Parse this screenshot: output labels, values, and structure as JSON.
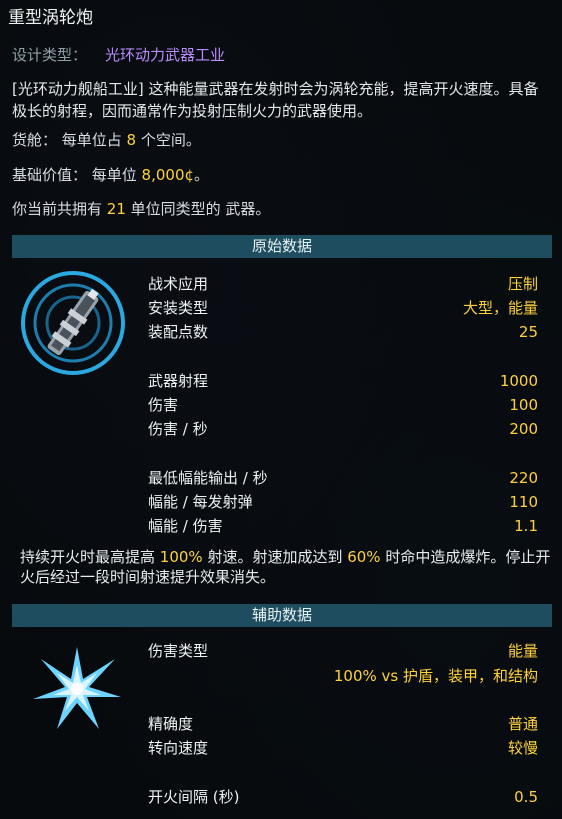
{
  "weapon": {
    "name": "重型涡轮炮",
    "design_type_label": "设计类型：",
    "design_type_value": "光环动力武器工业",
    "description": "[光环动力舰船工业] 这种能量武器在发射时会为涡轮充能，提高开火速度。具备极长的射程，因而通常作为投射压制火力的武器使用。",
    "cargo_prefix": "货舱：  每单位占 ",
    "cargo_value": "8",
    "cargo_suffix": " 个空间。",
    "price_prefix": "基础价值：  每单位 ",
    "price_value": "8,000¢",
    "price_suffix": "。",
    "own_prefix": "你当前共拥有 ",
    "own_value": "21",
    "own_suffix": " 单位同类型的 武器。"
  },
  "primary": {
    "header": "原始数据",
    "icon": "turbo-cannon-weapon-icon",
    "rows": [
      {
        "label": "战术应用",
        "value": "压制"
      },
      {
        "label": "安装类型",
        "value": "大型，能量"
      },
      {
        "label": "装配点数",
        "value": "25"
      },
      {
        "label": "武器射程",
        "value": "1000"
      },
      {
        "label": "伤害",
        "value": "100"
      },
      {
        "label": "伤害 / 秒",
        "value": "200"
      },
      {
        "label": "最低幅能输出 / 秒",
        "value": "220"
      },
      {
        "label": "幅能 / 每发射弹",
        "value": "110"
      },
      {
        "label": "幅能 / 伤害",
        "value": "1.1"
      }
    ],
    "note_parts": {
      "a": "持续开火时最高提高 ",
      "b": "100%",
      "c": " 射速。射速加成达到 ",
      "d": "60%",
      "e": " 时命中造成爆炸。停止开火后经过一段时间射速提升效果消失。"
    }
  },
  "ancillary": {
    "header": "辅助数据",
    "icon": "energy-burst-icon",
    "rows": [
      {
        "label": "伤害类型",
        "value": "能量"
      },
      {
        "label": "",
        "value": "100% vs 护盾，装甲，和结构"
      },
      {
        "label": "精确度",
        "value": "普通"
      },
      {
        "label": "转向速度",
        "value": "较慢"
      },
      {
        "label": "开火间隔 (秒)",
        "value": "0.5"
      }
    ]
  },
  "colors": {
    "highlight": "#ffd23c",
    "manufacturer": "#b98cff",
    "header_bar": "#1e4d60",
    "icon_ring": "#2aa8e0"
  }
}
